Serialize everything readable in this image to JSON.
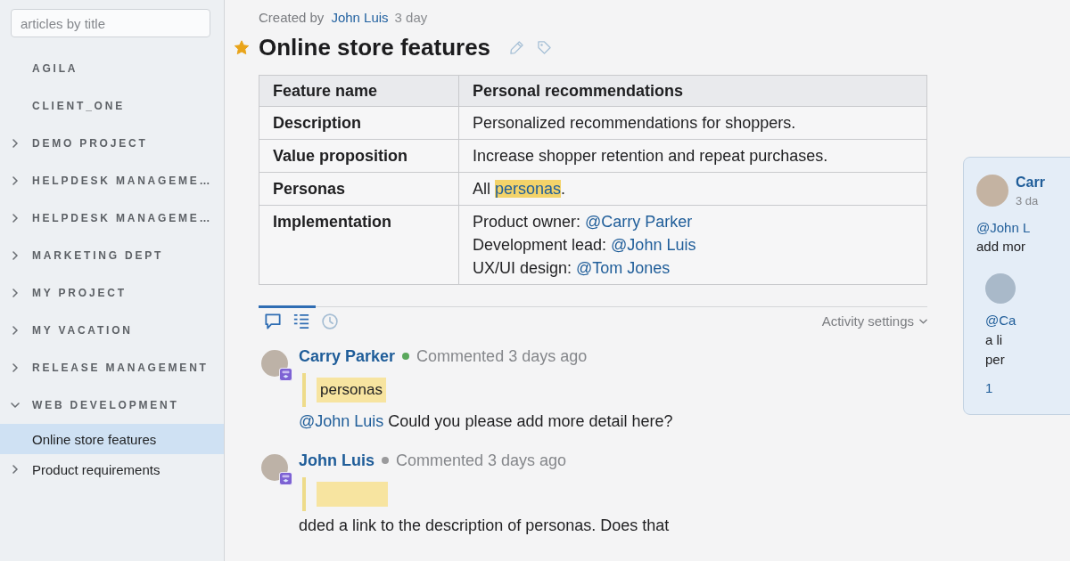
{
  "sidebar": {
    "search": {
      "placeholder": "articles by title"
    },
    "items": [
      {
        "label": "AGILA",
        "selected": false
      },
      {
        "label": "CLIENT_ONE",
        "selected": false
      },
      {
        "label": "DEMO PROJECT",
        "selected": false,
        "expanded": false
      },
      {
        "label": "HELPDESK MANAGEME…",
        "selected": false,
        "expanded": false
      },
      {
        "label": "HELPDESK MANAGEME…",
        "selected": false,
        "expanded": false
      },
      {
        "label": "MARKETING DEPT",
        "selected": false,
        "expanded": false
      },
      {
        "label": "MY PROJECT",
        "selected": false,
        "expanded": false
      },
      {
        "label": "MY VACATION",
        "selected": false,
        "expanded": false
      },
      {
        "label": "RELEASE MANAGEMENT",
        "selected": false,
        "expanded": false
      },
      {
        "label": "WEB DEVELOPMENT",
        "selected": false,
        "expanded": true,
        "children": [
          {
            "label": "Online store features",
            "selected": true
          },
          {
            "label": "Product requirements",
            "selected": false,
            "expanded": false
          }
        ]
      }
    ]
  },
  "page": {
    "meta": {
      "label": "Created by",
      "author": "John Luis",
      "time": "3 day"
    },
    "starred": true,
    "title": "Online store features",
    "table": {
      "columns": [
        "Feature name",
        "Personal recommendations"
      ],
      "rows": [
        {
          "label": "Description",
          "lines": [
            [
              {
                "kind": "plain",
                "text": "Personalized recommendations for shoppers."
              }
            ]
          ]
        },
        {
          "label": "Value proposition",
          "lines": [
            [
              {
                "kind": "plain",
                "text": "Increase shopper retention and repeat purchases."
              }
            ]
          ]
        },
        {
          "label": "Personas",
          "lines": [
            [
              {
                "kind": "plain",
                "text": "All "
              },
              {
                "kind": "highlight",
                "text": "personas"
              },
              {
                "kind": "plain",
                "text": "."
              }
            ]
          ]
        },
        {
          "label": "Implementation",
          "lines": [
            [
              {
                "kind": "plain",
                "text": "Product owner: "
              },
              {
                "kind": "mention",
                "text": "@Carry Parker"
              }
            ],
            [
              {
                "kind": "plain",
                "text": "Development lead: "
              },
              {
                "kind": "mention",
                "text": "@John Luis"
              }
            ],
            [
              {
                "kind": "plain",
                "text": "UX/UI design: "
              },
              {
                "kind": "mention",
                "text": "@Tom Jones"
              }
            ]
          ]
        }
      ]
    }
  },
  "activity": {
    "tabs": [
      {
        "kind": "comments",
        "selected": true
      },
      {
        "kind": "list",
        "selected": true
      },
      {
        "kind": "history",
        "selected": false
      }
    ],
    "settings": "Activity settings"
  },
  "comments": [
    {
      "author": "Carry Parker",
      "color": "#5aa85c",
      "time": "Commented 3 days ago",
      "quoted": true,
      "quote": "personas",
      "body": [
        {
          "kind": "mention",
          "text": "@John Luis"
        },
        {
          "kind": "plain",
          "text": " Could you please add more detail here?"
        }
      ]
    },
    {
      "author": "John Luis",
      "color": "#9a9a9c",
      "time": "Commented 3 days ago",
      "quoted": true,
      "body": [
        {
          "kind": "plain",
          "text": "dded a link to the description of personas. Does that"
        }
      ]
    }
  ],
  "side_panel": {
    "comments": [
      {
        "kind": "comment",
        "author": "Carr",
        "time": "3 da",
        "lines": [
          {
            "kind": "mention",
            "text": "@John L"
          },
          {
            "kind": "plain",
            "text": "add mor"
          }
        ]
      },
      {
        "kind": "reply",
        "lines": [
          {
            "kind": "mention",
            "text": "@Ca"
          },
          {
            "kind": "plain",
            "text": "a li"
          },
          {
            "kind": "plain",
            "text": "per"
          }
        ]
      }
    ],
    "replies_link": "1"
  }
}
